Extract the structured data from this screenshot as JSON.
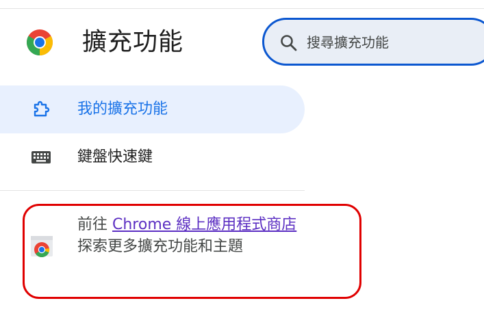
{
  "header": {
    "title": "擴充功能",
    "logo_icon": "chrome-logo-icon"
  },
  "search": {
    "placeholder": "搜尋擴充功能",
    "value": "",
    "icon": "search-icon"
  },
  "sidebar": {
    "items": [
      {
        "label": "我的擴充功能",
        "icon": "puzzle-piece-icon",
        "selected": true
      },
      {
        "label": "鍵盤快速鍵",
        "icon": "keyboard-icon",
        "selected": false
      }
    ]
  },
  "promo": {
    "prefix": "前往 ",
    "link_text": "Chrome 線上應用程式商店",
    "suffix": " 探索更多擴充功能和主題",
    "icon": "chrome-web-store-icon"
  },
  "colors": {
    "accent": "#0b57d0",
    "selected_bg": "#e8f0fe",
    "selected_text": "#1a73e8",
    "highlight_border": "#e00000",
    "link": "#5b2ec2"
  }
}
